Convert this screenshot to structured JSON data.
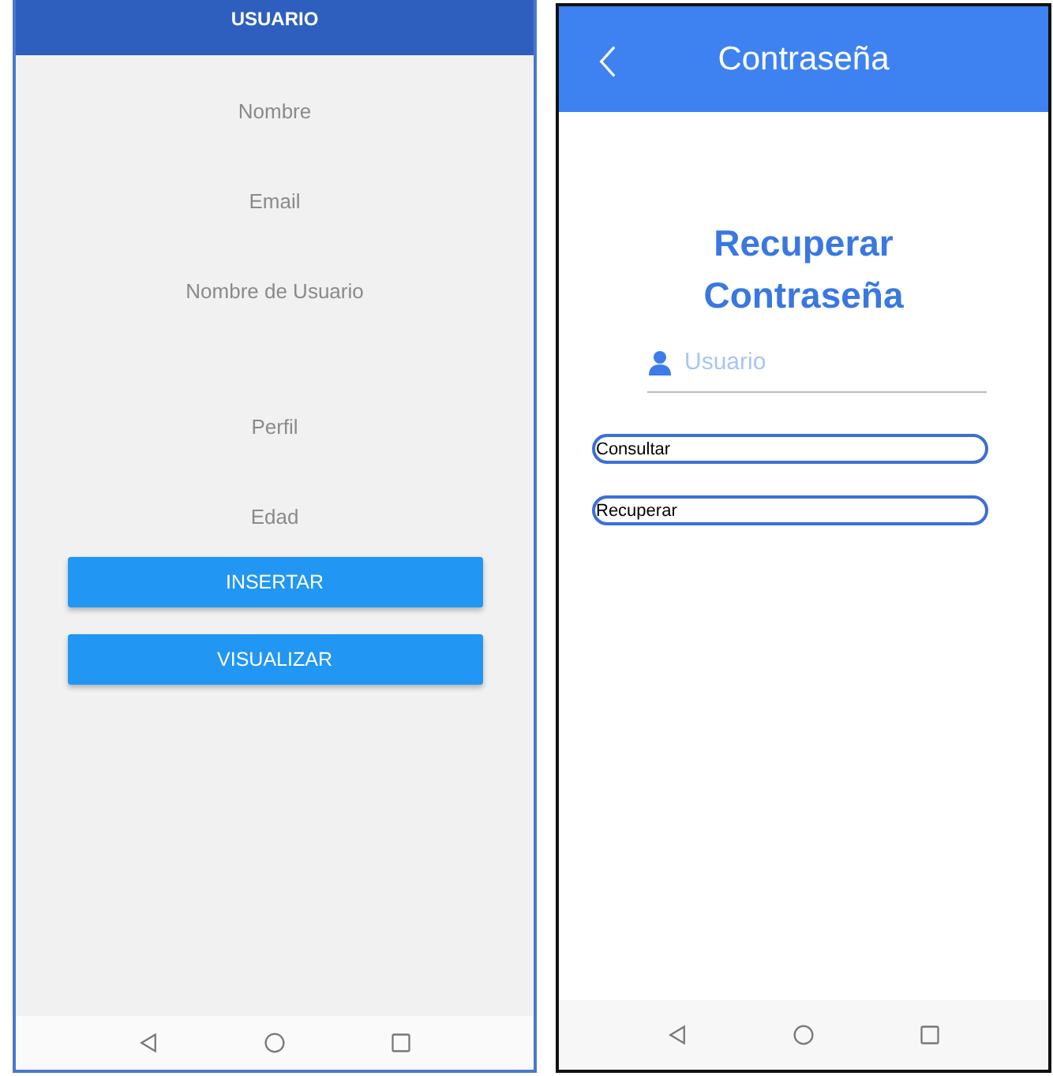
{
  "left_screen": {
    "title": "USUARIO",
    "fields": [
      {
        "placeholder": "Nombre"
      },
      {
        "placeholder": "Email"
      },
      {
        "placeholder": "Nombre de Usuario"
      },
      {
        "placeholder": "Perfil"
      },
      {
        "placeholder": "Edad"
      }
    ],
    "buttons": [
      "INSERTAR",
      "VISUALIZAR"
    ]
  },
  "right_screen": {
    "title": "Contraseña",
    "heading": "Recuperar Contraseña",
    "user_field": {
      "placeholder": "Usuario"
    },
    "buttons": [
      "Consultar",
      "Recuperar"
    ]
  }
}
